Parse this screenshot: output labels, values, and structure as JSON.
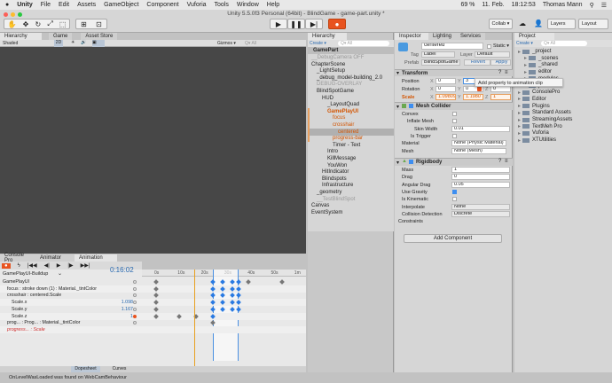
{
  "menubar": {
    "apple": "",
    "items": [
      "Unity",
      "File",
      "Edit",
      "Assets",
      "GameObject",
      "Component",
      "Vuforia",
      "Tools",
      "Window",
      "Help"
    ],
    "battery": "69 %",
    "date": "11. Feb.",
    "time": "18:12:53",
    "user": "Thomas Mann"
  },
  "toolbar": {
    "title": "Unity 5.5.0f3 Personal (64bit) - BlindGame - game-part.unity *",
    "collab": "Collab ▾",
    "layers": "Layers",
    "layout": "Layout"
  },
  "scene": {
    "tabs": [
      "Hierarchy",
      "Game",
      "Asset Store"
    ],
    "shading": "Shaded",
    "mode2d": "2D",
    "gizmos": "Gizmos ▾",
    "search": "Q▾ All"
  },
  "hierarchy": {
    "tab": "Hierarchy",
    "create": "Create ▾",
    "search": "Q▾ All",
    "root": "GamePart",
    "items": [
      {
        "label": "__DebugCamera OFF",
        "depth": 0,
        "style": "gray"
      },
      {
        "label": "ChapterScene",
        "depth": 0,
        "style": ""
      },
      {
        "label": "_LightSetup",
        "depth": 1,
        "style": ""
      },
      {
        "label": "_debug_model-building_2.0",
        "depth": 1,
        "style": ""
      },
      {
        "label": "DEBUG-OVERLAY",
        "depth": 1,
        "style": "gray"
      },
      {
        "label": "BlindSpotGame",
        "depth": 1,
        "style": ""
      },
      {
        "label": "HUD",
        "depth": 2,
        "style": ""
      },
      {
        "label": "_LayoutQuad",
        "depth": 3,
        "style": ""
      },
      {
        "label": "GamePlayUI",
        "depth": 3,
        "style": "orange bold"
      },
      {
        "label": "focus",
        "depth": 4,
        "style": "orange"
      },
      {
        "label": "crosshair",
        "depth": 4,
        "style": "orange"
      },
      {
        "label": "centered",
        "depth": 5,
        "style": "orange selected"
      },
      {
        "label": "progress-bar",
        "depth": 4,
        "style": "orange"
      },
      {
        "label": "Timer - Text",
        "depth": 4,
        "style": ""
      },
      {
        "label": "Intro",
        "depth": 3,
        "style": ""
      },
      {
        "label": "KillMessage",
        "depth": 3,
        "style": ""
      },
      {
        "label": "YouWon",
        "depth": 3,
        "style": ""
      },
      {
        "label": "HitIndicator",
        "depth": 2,
        "style": ""
      },
      {
        "label": "Blindspots",
        "depth": 2,
        "style": ""
      },
      {
        "label": "Infrastructure",
        "depth": 2,
        "style": ""
      },
      {
        "label": "_geometry",
        "depth": 1,
        "style": ""
      },
      {
        "label": "__TestBlindSpot",
        "depth": 1,
        "style": "gray"
      },
      {
        "label": "Canvas",
        "depth": 0,
        "style": ""
      },
      {
        "label": "EventSystem",
        "depth": 0,
        "style": ""
      }
    ]
  },
  "inspector": {
    "tabs": [
      "Inspector",
      "Lighting",
      "Services"
    ],
    "name": "centered",
    "static": "Static ▾",
    "tag_label": "Tag",
    "tag": "Label",
    "layer_label": "Layer",
    "layer": "Default",
    "prefab_label": "Prefab",
    "prefab": "BlindSpotGame",
    "revert": "Revert",
    "apply": "Apply",
    "transform": {
      "title": "Transform",
      "position_label": "Position",
      "rotation_label": "Rotation",
      "scale_label": "Scale",
      "position": [
        "0",
        "3",
        "0"
      ],
      "rotation": [
        "0",
        "0",
        "0"
      ],
      "scale": [
        "1.09809",
        "1.1980",
        "1"
      ],
      "axes": [
        "X",
        "Y",
        "Z"
      ]
    },
    "tooltip": "Add property to animation clip",
    "mesh_collider": {
      "title": "Mesh Collider",
      "convex": "Convex",
      "inflate": "Inflate Mesh",
      "skin_label": "Skin Width",
      "skin": "0.01",
      "trigger": "Is Trigger",
      "material_label": "Material",
      "material": "None (Physic Material)",
      "mesh_label": "Mesh",
      "mesh": "None (Mesh)"
    },
    "rigidbody": {
      "title": "Rigidbody",
      "mass_label": "Mass",
      "mass": "1",
      "drag_label": "Drag",
      "drag": "0",
      "adrag_label": "Angular Drag",
      "adrag": "0.05",
      "gravity": "Use Gravity",
      "kinematic": "Is Kinematic",
      "interp_label": "Interpolate",
      "interp": "None",
      "coll_label": "Collision Detection",
      "coll": "Discrete",
      "constraints": "Constraints"
    },
    "add_component": "Add Component"
  },
  "project": {
    "tab": "Project",
    "create": "Create ▾",
    "search": "Q▾ All",
    "items": [
      {
        "label": "_project",
        "depth": 0
      },
      {
        "label": "_scenes",
        "depth": 1
      },
      {
        "label": "_shared",
        "depth": 1
      },
      {
        "label": "editor",
        "depth": 1
      },
      {
        "label": "modules",
        "depth": 1
      },
      {
        "label": "parts",
        "depth": 1
      },
      {
        "label": "ConsolePro",
        "depth": 0
      },
      {
        "label": "Editor",
        "depth": 0
      },
      {
        "label": "Plugins",
        "depth": 0
      },
      {
        "label": "Standard Assets",
        "depth": 0
      },
      {
        "label": "StreamingAssets",
        "depth": 0
      },
      {
        "label": "TextMeh Pro",
        "depth": 0
      },
      {
        "label": "Vuforia",
        "depth": 0
      },
      {
        "label": "XTUtilities",
        "depth": 0
      }
    ]
  },
  "animation": {
    "tabs": [
      "Console Pro",
      "Animator",
      "Animation"
    ],
    "time": "0:16:02",
    "clip": "GamePlayUI-Buildup",
    "ticks": [
      "0s",
      "10s",
      "20s",
      "30s",
      "40s",
      "50s",
      "1m"
    ],
    "playhead_s": 16.5,
    "selection_s": [
      24.3,
      35.4
    ],
    "rows": [
      {
        "label": "GamePlayUI",
        "indent": 0,
        "value": "",
        "keys": [
          [
            0,
            "g"
          ],
          [
            24.3,
            "b"
          ],
          [
            28.5,
            "b"
          ],
          [
            32.7,
            "b"
          ],
          [
            35.4,
            "b"
          ],
          [
            39.5,
            "g"
          ],
          [
            54,
            "g"
          ]
        ]
      },
      {
        "label": "focus : stroke down (1) : Material._tintColor",
        "indent": 1,
        "value": "",
        "keys": [
          [
            0,
            "g"
          ],
          [
            24.3,
            "b"
          ],
          [
            28.5,
            "b"
          ],
          [
            32.7,
            "b"
          ],
          [
            35.4,
            "b"
          ]
        ]
      },
      {
        "label": "crosshair : centered.Scale",
        "indent": 1,
        "value": "",
        "keys": [
          [
            0,
            "g"
          ],
          [
            24.3,
            "b"
          ],
          [
            28.5,
            "b"
          ],
          [
            32.7,
            "b"
          ],
          [
            35.4,
            "b"
          ]
        ]
      },
      {
        "label": "Scale.x",
        "indent": 2,
        "value": "1.098",
        "keys": [
          [
            0,
            "g"
          ],
          [
            24.3,
            "b"
          ],
          [
            28.5,
            "b"
          ],
          [
            32.7,
            "b"
          ],
          [
            35.4,
            "b"
          ]
        ]
      },
      {
        "label": "Scale.y",
        "indent": 2,
        "value": "1.167",
        "keys": [
          [
            0,
            "g"
          ],
          [
            24.3,
            "b"
          ],
          [
            28.5,
            "b"
          ],
          [
            32.7,
            "b"
          ],
          [
            35.4,
            "b"
          ]
        ]
      },
      {
        "label": "Scale.z",
        "indent": 2,
        "value": "1",
        "keys": [
          [
            0,
            "g"
          ],
          [
            9.9,
            "g"
          ],
          [
            17.1,
            "g"
          ],
          [
            24.3,
            "b"
          ]
        ]
      },
      {
        "label": "prog... : Prog... : Material._tintColor",
        "indent": 1,
        "value": "",
        "keys": [
          [
            24.3,
            "g"
          ]
        ]
      },
      {
        "label": "progress... : Scale",
        "indent": 1,
        "value": "",
        "missing": true,
        "keys": []
      }
    ],
    "dopesheet": "Dopesheet",
    "curves": "Curves"
  },
  "status": "OnLevelWasLoaded was found on WebCamBehaviour"
}
